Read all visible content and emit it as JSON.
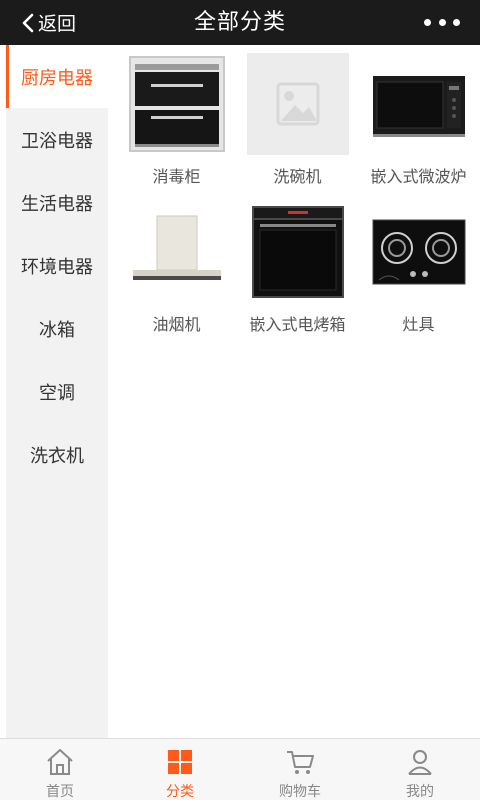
{
  "header": {
    "back_label": "返回",
    "title": "全部分类"
  },
  "sidebar": {
    "items": [
      {
        "label": "厨房电器",
        "active": true
      },
      {
        "label": "卫浴电器",
        "active": false
      },
      {
        "label": "生活电器",
        "active": false
      },
      {
        "label": "环境电器",
        "active": false
      },
      {
        "label": "冰箱",
        "active": false
      },
      {
        "label": "空调",
        "active": false
      },
      {
        "label": "洗衣机",
        "active": false
      }
    ]
  },
  "products": [
    {
      "name": "消毒柜",
      "icon": "disinfection-cabinet-image"
    },
    {
      "name": "洗碗机",
      "icon": "image-placeholder"
    },
    {
      "name": "嵌入式微波炉",
      "icon": "built-in-microwave-image"
    },
    {
      "name": "油烟机",
      "icon": "range-hood-image"
    },
    {
      "name": "嵌入式电烤箱",
      "icon": "built-in-oven-image"
    },
    {
      "name": "灶具",
      "icon": "gas-stove-image"
    }
  ],
  "tabbar": {
    "items": [
      {
        "label": "首页",
        "icon": "home-icon",
        "active": false
      },
      {
        "label": "分类",
        "icon": "category-grid-icon",
        "active": true
      },
      {
        "label": "购物车",
        "icon": "cart-icon",
        "active": false
      },
      {
        "label": "我的",
        "icon": "user-icon",
        "active": false
      }
    ]
  },
  "colors": {
    "header_bg": "#1b1b1b",
    "accent": "#ff5a1a",
    "sidebar_bg": "#f2f2f2"
  }
}
